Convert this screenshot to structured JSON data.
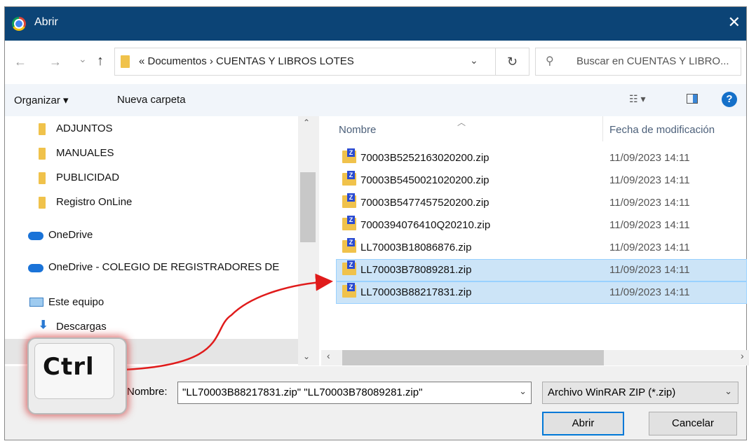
{
  "window": {
    "title": "Abrir",
    "close": "✕"
  },
  "nav": {
    "back": "←",
    "forward": "→",
    "recent": "⌄",
    "up": "↑"
  },
  "address": {
    "breadcrumb": "«  Documentos  ›  CUENTAS Y LIBROS LOTES",
    "dropdown": "⌄",
    "refresh": "↻"
  },
  "search": {
    "placeholder": "Buscar en CUENTAS Y LIBRO..."
  },
  "toolbar": {
    "organize": "Organizar ▾",
    "new_folder": "Nueva carpeta"
  },
  "sidebar": {
    "items": [
      {
        "label": "ADJUNTOS",
        "icon": "folder-icon"
      },
      {
        "label": "MANUALES",
        "icon": "folder-icon"
      },
      {
        "label": "PUBLICIDAD",
        "icon": "folder-icon"
      },
      {
        "label": "Registro OnLine",
        "icon": "folder-icon"
      },
      {
        "label": "OneDrive",
        "icon": "onedrive-icon"
      },
      {
        "label": "OneDrive - COLEGIO DE REGISTRADORES DE",
        "icon": "onedrive-icon"
      },
      {
        "label": "Este equipo",
        "icon": "computer-icon"
      },
      {
        "label": "Descargas",
        "icon": "download-icon"
      }
    ]
  },
  "columns": {
    "name": "Nombre",
    "date": "Fecha de modificación"
  },
  "files": [
    {
      "name": "70003B5252163020200.zip",
      "date": "11/09/2023 14:11",
      "selected": false
    },
    {
      "name": "70003B5450021020200.zip",
      "date": "11/09/2023 14:11",
      "selected": false
    },
    {
      "name": "70003B5477457520200.zip",
      "date": "11/09/2023 14:11",
      "selected": false
    },
    {
      "name": "7000394076410Q20210.zip",
      "date": "11/09/2023 14:11",
      "selected": false
    },
    {
      "name": "LL70003B18086876.zip",
      "date": "11/09/2023 14:11",
      "selected": false
    },
    {
      "name": "LL70003B78089281.zip",
      "date": "11/09/2023 14:11",
      "selected": true
    },
    {
      "name": "LL70003B88217831.zip",
      "date": "11/09/2023 14:11",
      "selected": true
    }
  ],
  "footer": {
    "name_label": "Nombre:",
    "name_value": "\"LL70003B88217831.zip\" \"LL70003B78089281.zip\"",
    "file_type": "Archivo WinRAR ZIP (*.zip)",
    "open": "Abrir",
    "cancel": "Cancelar"
  },
  "overlay": {
    "key_label": "Ctrl",
    "accent_color": "#e01b1b"
  },
  "colors": {
    "titlebar": "#0c4476",
    "selection": "#cce4f7",
    "primary_border": "#0078d7"
  }
}
